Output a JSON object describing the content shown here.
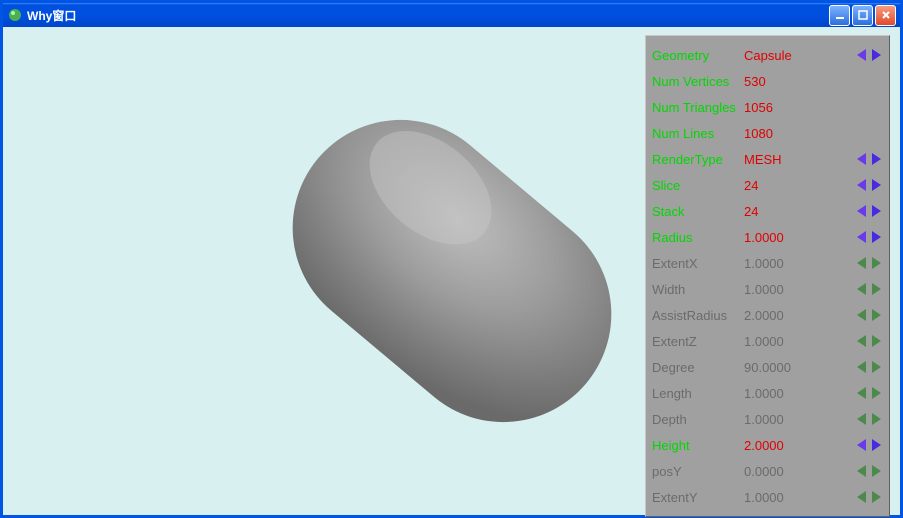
{
  "window": {
    "title": "Why窗口"
  },
  "panel": {
    "rows": [
      {
        "label": "Geometry",
        "value": "Capsule",
        "active": true,
        "hasArrows": true
      },
      {
        "label": "Num Vertices",
        "value": "530",
        "active": true,
        "hasArrows": false
      },
      {
        "label": "Num Triangles",
        "value": "1056",
        "active": true,
        "hasArrows": false
      },
      {
        "label": "Num Lines",
        "value": "1080",
        "active": true,
        "hasArrows": false
      },
      {
        "label": "RenderType",
        "value": "MESH",
        "active": true,
        "hasArrows": true
      },
      {
        "label": "Slice",
        "value": "24",
        "active": true,
        "hasArrows": true
      },
      {
        "label": "Stack",
        "value": "24",
        "active": true,
        "hasArrows": true
      },
      {
        "label": "Radius",
        "value": "1.0000",
        "active": true,
        "hasArrows": true
      },
      {
        "label": "ExtentX",
        "value": "1.0000",
        "active": false,
        "hasArrows": true
      },
      {
        "label": "Width",
        "value": "1.0000",
        "active": false,
        "hasArrows": true
      },
      {
        "label": "AssistRadius",
        "value": "2.0000",
        "active": false,
        "hasArrows": true
      },
      {
        "label": "ExtentZ",
        "value": "1.0000",
        "active": false,
        "hasArrows": true
      },
      {
        "label": "Degree",
        "value": "90.0000",
        "active": false,
        "hasArrows": true
      },
      {
        "label": "Length",
        "value": "1.0000",
        "active": false,
        "hasArrows": true
      },
      {
        "label": "Depth",
        "value": "1.0000",
        "active": false,
        "hasArrows": true
      },
      {
        "label": "Height",
        "value": "2.0000",
        "active": true,
        "hasArrows": true
      },
      {
        "label": "posY",
        "value": "0.0000",
        "active": false,
        "hasArrows": true
      },
      {
        "label": "ExtentY",
        "value": "1.0000",
        "active": false,
        "hasArrows": true
      }
    ]
  }
}
